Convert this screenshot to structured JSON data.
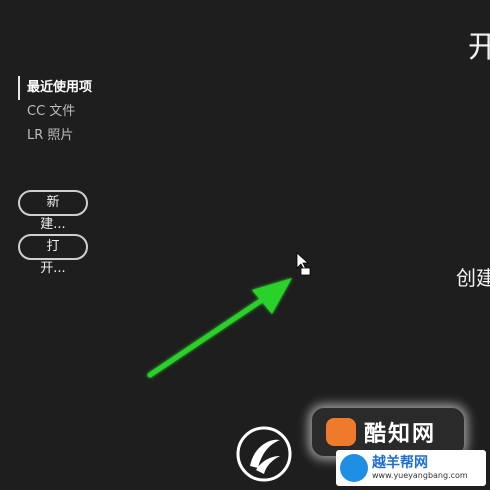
{
  "sidebar": {
    "items": [
      {
        "label": "最近使用项",
        "active": true
      },
      {
        "label": "CC 文件",
        "active": false
      },
      {
        "label": "LR 照片",
        "active": false
      }
    ]
  },
  "actions": {
    "new_label": "新建...",
    "open_label": "打开..."
  },
  "main": {
    "title": "开",
    "create_text": "创建"
  },
  "watermark": {
    "badge_text": "酷知网",
    "site_name": "越羊帮网",
    "site_url": "www.yueyangbang.com"
  },
  "colors": {
    "background": "#1e1e1e",
    "arrow": "#2bd12b",
    "badge_orange": "#f07a2b"
  }
}
